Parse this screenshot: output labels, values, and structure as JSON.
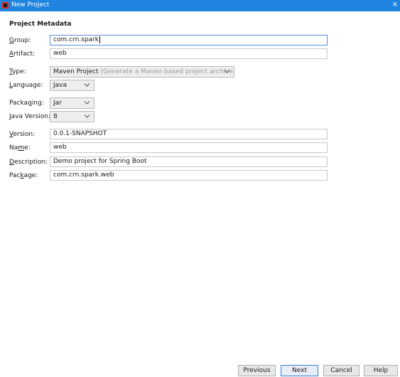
{
  "window": {
    "title": "New Project",
    "close_glyph": "×"
  },
  "section_title": "Project Metadata",
  "fields": {
    "group": {
      "label_pre": "",
      "label_mn": "G",
      "label_post": "roup:",
      "value": "com.crn.spark"
    },
    "artifact": {
      "label_pre": "",
      "label_mn": "A",
      "label_post": "rtifact:",
      "value": "web"
    },
    "type": {
      "label_pre": "",
      "label_mn": "T",
      "label_post": "ype:",
      "value": "Maven Project",
      "hint": "(Generate a Maven based project archive.)"
    },
    "language": {
      "label_pre": "",
      "label_mn": "L",
      "label_post": "anguage:",
      "value": "Java"
    },
    "packaging": {
      "label_pre": "Packa",
      "label_mn": "g",
      "label_post": "ing:",
      "value": "Jar"
    },
    "java_version": {
      "label_pre": "",
      "label_mn": "J",
      "label_post": "ava Version:",
      "value": "8"
    },
    "version": {
      "label_pre": "",
      "label_mn": "V",
      "label_post": "ersion:",
      "value": "0.0.1-SNAPSHOT"
    },
    "name": {
      "label_pre": "Na",
      "label_mn": "m",
      "label_post": "e:",
      "value": "web"
    },
    "description": {
      "label_pre": "",
      "label_mn": "D",
      "label_post": "escription:",
      "value": "Demo project for Spring Boot"
    },
    "package": {
      "label_pre": "Pac",
      "label_mn": "k",
      "label_post": "age:",
      "value": "com.crn.spark.web"
    }
  },
  "buttons": {
    "previous": "Previous",
    "next": "Next",
    "cancel": "Cancel",
    "help": "Help"
  },
  "colors": {
    "titlebar": "#1f84e0",
    "focus_border": "#5b8fd6",
    "hint_text": "#9a9a9a"
  },
  "icons": {
    "app": "intellij-idea-icon",
    "close": "close-icon",
    "dropdown": "chevron-down-icon"
  }
}
